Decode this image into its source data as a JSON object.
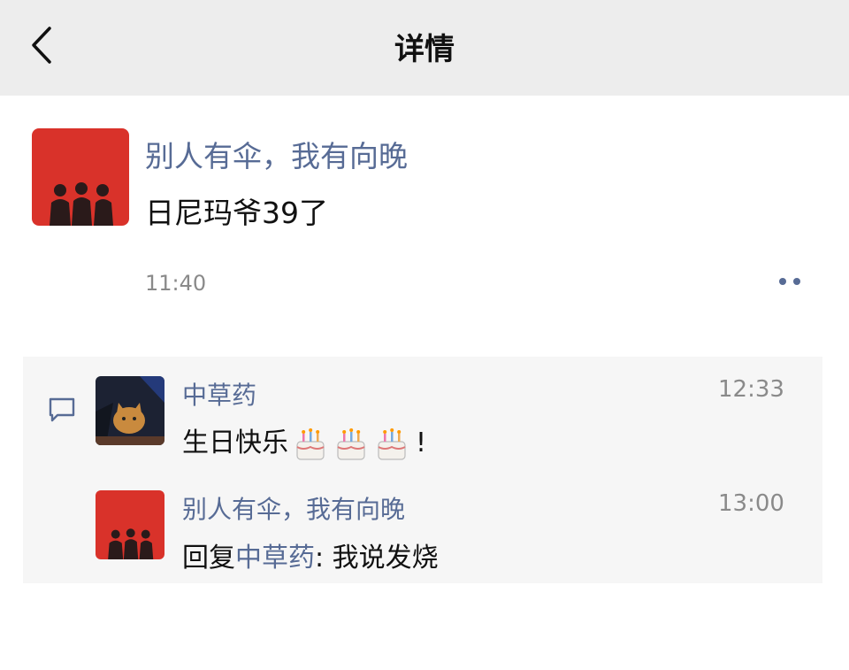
{
  "header": {
    "title": "详情",
    "back_icon": "chevron-left-icon"
  },
  "post": {
    "author": "别人有伞，我有向晚",
    "text": "日尼玛爷39了",
    "time": "11:40",
    "more_icon": "more-dots-icon"
  },
  "comments": [
    {
      "author": "中草药",
      "time": "12:33",
      "text": "生日快乐",
      "emoji": "birthday-cake-icon",
      "emoji_count": 3,
      "suffix": "!"
    },
    {
      "author": "别人有伞，我有向晚",
      "time": "13:00",
      "reply_prefix": "回复",
      "reply_to": "中草药",
      "reply_sep": ":",
      "text": "我说发烧"
    }
  ],
  "colors": {
    "link": "#576b95",
    "header_bg": "#ededed",
    "comment_bg": "#f6f6f6",
    "avatar_red": "#d9322a"
  }
}
